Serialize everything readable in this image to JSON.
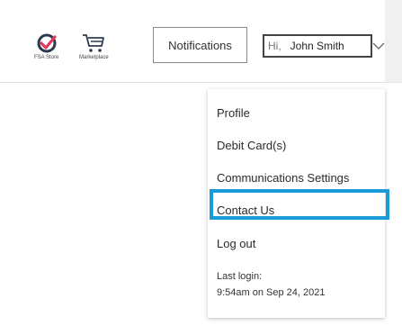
{
  "header": {
    "fsa_store_label": "FSA Store",
    "marketplace_label": "Marketplace",
    "notifications_label": "Notifications",
    "greeting": "Hi,",
    "user_name": "John Smith"
  },
  "icons": {
    "fsa_store": "check-badge-icon",
    "marketplace": "cart-icon",
    "user_menu_toggle": "chevron-down-icon"
  },
  "dropdown": {
    "items": [
      {
        "label": "Profile"
      },
      {
        "label": "Debit Card(s)"
      },
      {
        "label": "Communications Settings"
      },
      {
        "label": "Contact Us"
      },
      {
        "label": "Log out"
      }
    ],
    "last_login_label": "Last login:",
    "last_login_value": "9:54am on Sep 24, 2021"
  },
  "colors": {
    "highlight": "#1a9bd7",
    "fsa_icon": "#e03a5a",
    "icon_dark": "#2e3b4e"
  }
}
